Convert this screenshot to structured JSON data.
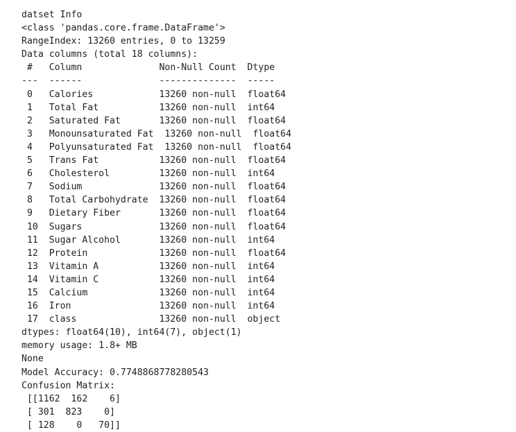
{
  "output": {
    "title": "datset Info",
    "class_line": "<class 'pandas.core.frame.DataFrame'>",
    "range_index": "RangeIndex: 13260 entries, 0 to 13259",
    "data_columns": "Data columns (total 18 columns):",
    "header": " #   Column              Non-Null Count  Dtype  ",
    "separator": "---  ------              --------------  -----  ",
    "columns": [
      " 0   Calories            13260 non-null  float64",
      " 1   Total Fat           13260 non-null  int64  ",
      " 2   Saturated Fat       13260 non-null  float64",
      " 3   Monounsaturated Fat  13260 non-null  float64",
      " 4   Polyunsaturated Fat  13260 non-null  float64",
      " 5   Trans Fat           13260 non-null  float64",
      " 6   Cholesterol         13260 non-null  int64  ",
      " 7   Sodium              13260 non-null  float64",
      " 8   Total Carbohydrate  13260 non-null  float64",
      " 9   Dietary Fiber       13260 non-null  float64",
      " 10  Sugars              13260 non-null  float64",
      " 11  Sugar Alcohol       13260 non-null  int64  ",
      " 12  Protein             13260 non-null  float64",
      " 13  Vitamin A           13260 non-null  int64  ",
      " 14  Vitamin C           13260 non-null  int64  ",
      " 15  Calcium             13260 non-null  int64  ",
      " 16  Iron                13260 non-null  int64  ",
      " 17  class               13260 non-null  object "
    ],
    "dtypes": "dtypes: float64(10), int64(7), object(1)",
    "memory": "memory usage: 1.8+ MB",
    "none": "None",
    "accuracy": "Model Accuracy: 0.7748868778280543",
    "confusion_label": "Confusion Matrix:",
    "matrix": [
      " [[1162  162    6]",
      " [ 301  823    0]",
      " [ 128    0   70]]"
    ]
  }
}
